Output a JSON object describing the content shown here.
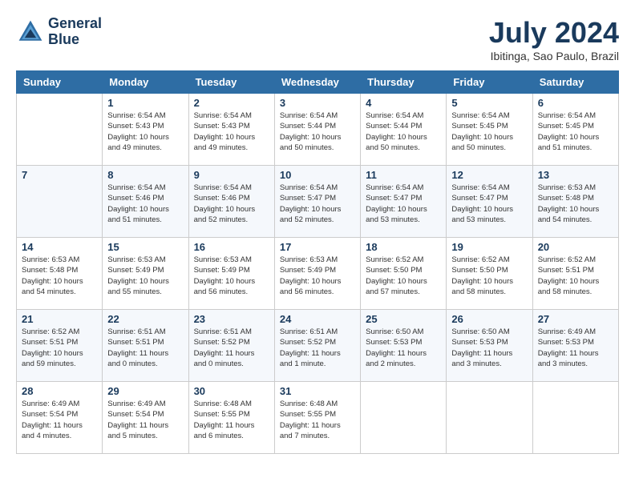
{
  "logo": {
    "line1": "General",
    "line2": "Blue"
  },
  "title": "July 2024",
  "subtitle": "Ibitinga, Sao Paulo, Brazil",
  "header": {
    "days": [
      "Sunday",
      "Monday",
      "Tuesday",
      "Wednesday",
      "Thursday",
      "Friday",
      "Saturday"
    ]
  },
  "weeks": [
    [
      {
        "day": "",
        "info": ""
      },
      {
        "day": "1",
        "info": "Sunrise: 6:54 AM\nSunset: 5:43 PM\nDaylight: 10 hours\nand 49 minutes."
      },
      {
        "day": "2",
        "info": "Sunrise: 6:54 AM\nSunset: 5:43 PM\nDaylight: 10 hours\nand 49 minutes."
      },
      {
        "day": "3",
        "info": "Sunrise: 6:54 AM\nSunset: 5:44 PM\nDaylight: 10 hours\nand 50 minutes."
      },
      {
        "day": "4",
        "info": "Sunrise: 6:54 AM\nSunset: 5:44 PM\nDaylight: 10 hours\nand 50 minutes."
      },
      {
        "day": "5",
        "info": "Sunrise: 6:54 AM\nSunset: 5:45 PM\nDaylight: 10 hours\nand 50 minutes."
      },
      {
        "day": "6",
        "info": "Sunrise: 6:54 AM\nSunset: 5:45 PM\nDaylight: 10 hours\nand 51 minutes."
      }
    ],
    [
      {
        "day": "7",
        "info": ""
      },
      {
        "day": "8",
        "info": "Sunrise: 6:54 AM\nSunset: 5:46 PM\nDaylight: 10 hours\nand 51 minutes."
      },
      {
        "day": "9",
        "info": "Sunrise: 6:54 AM\nSunset: 5:46 PM\nDaylight: 10 hours\nand 52 minutes."
      },
      {
        "day": "10",
        "info": "Sunrise: 6:54 AM\nSunset: 5:47 PM\nDaylight: 10 hours\nand 52 minutes."
      },
      {
        "day": "11",
        "info": "Sunrise: 6:54 AM\nSunset: 5:47 PM\nDaylight: 10 hours\nand 53 minutes."
      },
      {
        "day": "12",
        "info": "Sunrise: 6:54 AM\nSunset: 5:47 PM\nDaylight: 10 hours\nand 53 minutes."
      },
      {
        "day": "13",
        "info": "Sunrise: 6:53 AM\nSunset: 5:48 PM\nDaylight: 10 hours\nand 54 minutes."
      }
    ],
    [
      {
        "day": "14",
        "info": "Sunrise: 6:53 AM\nSunset: 5:48 PM\nDaylight: 10 hours\nand 54 minutes."
      },
      {
        "day": "15",
        "info": "Sunrise: 6:53 AM\nSunset: 5:49 PM\nDaylight: 10 hours\nand 55 minutes."
      },
      {
        "day": "16",
        "info": "Sunrise: 6:53 AM\nSunset: 5:49 PM\nDaylight: 10 hours\nand 56 minutes."
      },
      {
        "day": "17",
        "info": "Sunrise: 6:53 AM\nSunset: 5:49 PM\nDaylight: 10 hours\nand 56 minutes."
      },
      {
        "day": "18",
        "info": "Sunrise: 6:52 AM\nSunset: 5:50 PM\nDaylight: 10 hours\nand 57 minutes."
      },
      {
        "day": "19",
        "info": "Sunrise: 6:52 AM\nSunset: 5:50 PM\nDaylight: 10 hours\nand 58 minutes."
      },
      {
        "day": "20",
        "info": "Sunrise: 6:52 AM\nSunset: 5:51 PM\nDaylight: 10 hours\nand 58 minutes."
      }
    ],
    [
      {
        "day": "21",
        "info": "Sunrise: 6:52 AM\nSunset: 5:51 PM\nDaylight: 10 hours\nand 59 minutes."
      },
      {
        "day": "22",
        "info": "Sunrise: 6:51 AM\nSunset: 5:51 PM\nDaylight: 11 hours\nand 0 minutes."
      },
      {
        "day": "23",
        "info": "Sunrise: 6:51 AM\nSunset: 5:52 PM\nDaylight: 11 hours\nand 0 minutes."
      },
      {
        "day": "24",
        "info": "Sunrise: 6:51 AM\nSunset: 5:52 PM\nDaylight: 11 hours\nand 1 minute."
      },
      {
        "day": "25",
        "info": "Sunrise: 6:50 AM\nSunset: 5:53 PM\nDaylight: 11 hours\nand 2 minutes."
      },
      {
        "day": "26",
        "info": "Sunrise: 6:50 AM\nSunset: 5:53 PM\nDaylight: 11 hours\nand 3 minutes."
      },
      {
        "day": "27",
        "info": "Sunrise: 6:49 AM\nSunset: 5:53 PM\nDaylight: 11 hours\nand 3 minutes."
      }
    ],
    [
      {
        "day": "28",
        "info": "Sunrise: 6:49 AM\nSunset: 5:54 PM\nDaylight: 11 hours\nand 4 minutes."
      },
      {
        "day": "29",
        "info": "Sunrise: 6:49 AM\nSunset: 5:54 PM\nDaylight: 11 hours\nand 5 minutes."
      },
      {
        "day": "30",
        "info": "Sunrise: 6:48 AM\nSunset: 5:55 PM\nDaylight: 11 hours\nand 6 minutes."
      },
      {
        "day": "31",
        "info": "Sunrise: 6:48 AM\nSunset: 5:55 PM\nDaylight: 11 hours\nand 7 minutes."
      },
      {
        "day": "",
        "info": ""
      },
      {
        "day": "",
        "info": ""
      },
      {
        "day": "",
        "info": ""
      }
    ]
  ]
}
